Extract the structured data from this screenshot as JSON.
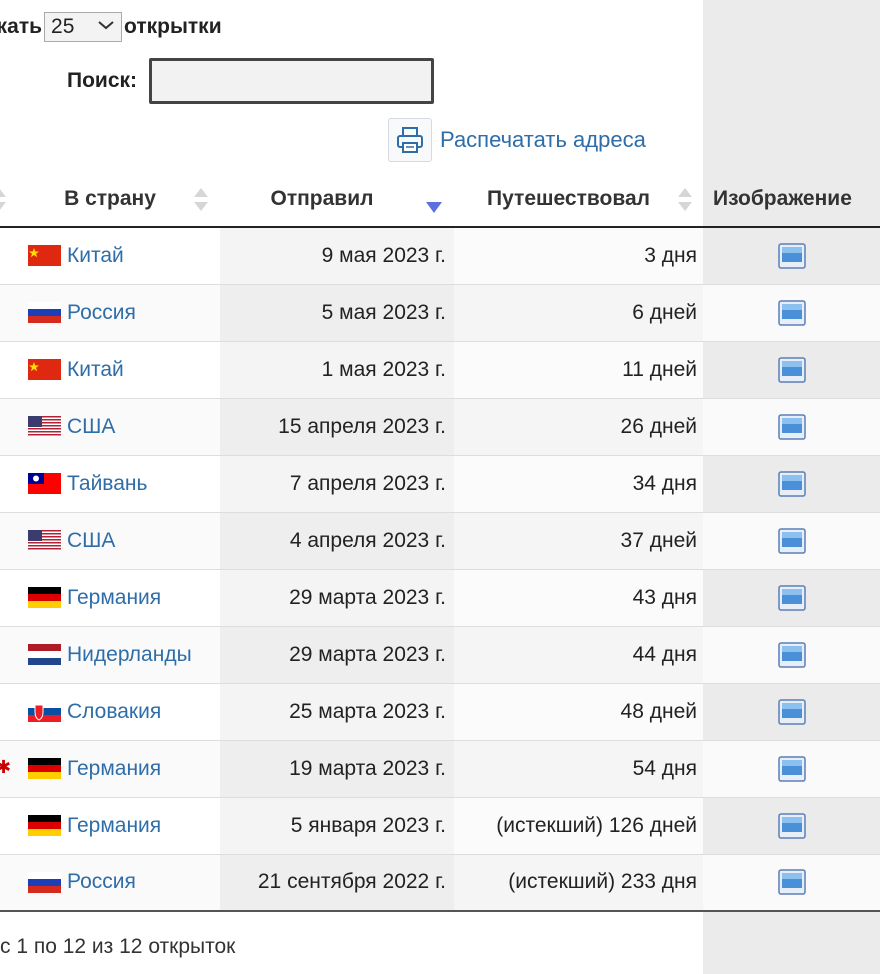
{
  "controls": {
    "show_prefix": "жать",
    "page_size": "25",
    "show_suffix": "открытки",
    "search_label": "Поиск:",
    "search_value": "",
    "print_label": "Распечатать адреса"
  },
  "table": {
    "headers": {
      "country": "В страну",
      "sent": "Отправил",
      "traveled": "Путешествовал",
      "image": "Изображение"
    },
    "rows": [
      {
        "flag": "cn",
        "country": "Китай",
        "sent": "9 мая 2023 г.",
        "traveled": "3 дня"
      },
      {
        "flag": "ru",
        "country": "Россия",
        "sent": "5 мая 2023 г.",
        "traveled": "6 дней"
      },
      {
        "flag": "cn",
        "country": "Китай",
        "sent": "1 мая 2023 г.",
        "traveled": "11 дней"
      },
      {
        "flag": "us",
        "country": "США",
        "sent": "15 апреля 2023 г.",
        "traveled": "26 дней"
      },
      {
        "flag": "tw",
        "country": "Тайвань",
        "sent": "7 апреля 2023 г.",
        "traveled": "34 дня"
      },
      {
        "flag": "us",
        "country": "США",
        "sent": "4 апреля 2023 г.",
        "traveled": "37 дней"
      },
      {
        "flag": "de",
        "country": "Германия",
        "sent": "29 марта 2023 г.",
        "traveled": "43 дня"
      },
      {
        "flag": "nl",
        "country": "Нидерланды",
        "sent": "29 марта 2023 г.",
        "traveled": "44 дня"
      },
      {
        "flag": "sk",
        "country": "Словакия",
        "sent": "25 марта 2023 г.",
        "traveled": "48 дней"
      },
      {
        "flag": "de",
        "country": "Германия",
        "sent": "19 марта 2023 г.",
        "traveled": "54 дня"
      },
      {
        "flag": "de",
        "country": "Германия",
        "sent": "5 января 2023 г.",
        "traveled": "(истекший) 126 дней"
      },
      {
        "flag": "ru",
        "country": "Россия",
        "sent": "21 сентября 2022 г.",
        "traveled": "(истекший) 233 дня"
      }
    ]
  },
  "footer": {
    "summary": "с 1 по 12 из 12 открыток"
  },
  "colors": {
    "link": "#2f6da8",
    "sort_active": "#5c6fe0",
    "sort_inactive": "#d6d6d6",
    "sidebar": "#ebebeb"
  },
  "icons": {
    "print": "printer-icon",
    "image": "image-icon"
  }
}
